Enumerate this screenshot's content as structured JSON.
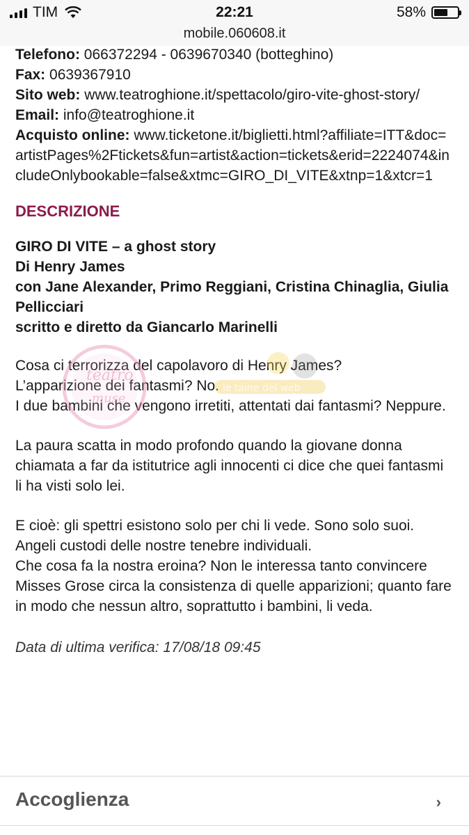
{
  "status": {
    "carrier": "TIM",
    "time": "22:21",
    "battery": "58%",
    "battery_level": 0.58
  },
  "url": "mobile.060608.it",
  "info": {
    "telefono_label": "Telefono:",
    "telefono": "066372294 - 0639670340 (botteghino)",
    "fax_label": "Fax:",
    "fax": "0639367910",
    "sito_label": "Sito web:",
    "sito": "www.teatroghione.it/spettacolo/giro-vite-ghost-story/",
    "email_label": "Email:",
    "email": "info@teatroghione.it",
    "acquisto_label": "Acquisto online:",
    "acquisto": "www.ticketone.it/biglietti.html?affiliate=ITT&doc=artistPages%2Ftickets&fun=artist&action=tickets&erid=2224074&includeOnlybookable=false&xtmc=GIRO_DI_VITE&xtnp=1&xtcr=1"
  },
  "descrizione": {
    "heading": "DESCRIZIONE",
    "title": "GIRO DI VITE – a ghost story",
    "author": "Di Henry James",
    "cast": "con Jane Alexander, Primo Reggiani, Cristina Chinaglia, Giulia Pellicciari",
    "director": "scritto e diretto da Giancarlo Marinelli",
    "p1_l1": "Cosa ci terrorizza del capolavoro di Henry James?",
    "p1_l2": "L’apparizione dei fantasmi? No.",
    "p1_l3": "I due bambini che vengono irretiti, attentati dai fantasmi? Neppure.",
    "p2": "La paura scatta in modo profondo quando la giovane donna chiamata a far da istitutrice agli innocenti ci dice che quei fantasmi li ha visti solo lei.",
    "p3_l1": "E cioè: gli spettri esistono solo per chi li vede. Sono solo suoi. Angeli custodi delle nostre tenebre individuali.",
    "p3_l2": "Che cosa fa la nostra eroina? Non le interessa tanto convincere Misses Grose circa la consistenza di quelle apparizioni; quanto fare in modo che nessun altro, soprattutto i bambini, li veda.",
    "verify": "Data di ultima verifica: 17/08/18 09:45"
  },
  "accordion": {
    "label": "Accoglienza",
    "chevron": "›"
  },
  "watermark": {
    "text1": "teatro delle muse",
    "text2": "le taine del web"
  }
}
